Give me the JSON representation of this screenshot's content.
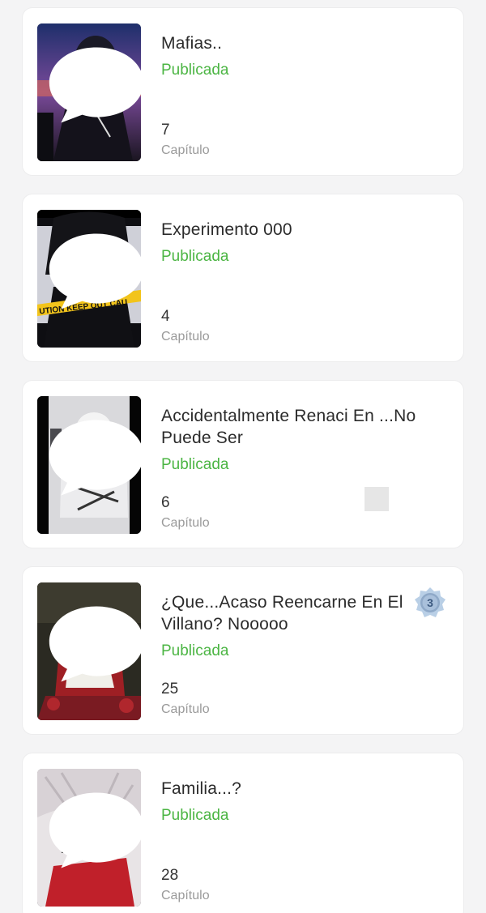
{
  "stories": [
    {
      "title": "Mafias..",
      "status": "Publicada",
      "chapters": "7",
      "chapters_label": "Capítulo",
      "cover_icon": "story-cover-image",
      "comment_icon": "comment-bubble-icon"
    },
    {
      "title": "Experimento 000",
      "status": "Publicada",
      "chapters": "4",
      "chapters_label": "Capítulo",
      "cover_icon": "story-cover-image",
      "comment_icon": "comment-bubble-icon",
      "cover_text": "UTION KEEP OUT  CAU"
    },
    {
      "title": "Accidentalmente Renaci En ...No Puede Ser",
      "status": "Publicada",
      "chapters": "6",
      "chapters_label": "Capítulo",
      "cover_icon": "story-cover-image",
      "comment_icon": "comment-bubble-icon"
    },
    {
      "title": "¿Que...Acaso Reencarne En El Villano? Nooooo",
      "status": "Publicada",
      "chapters": "25",
      "chapters_label": "Capítulo",
      "cover_icon": "story-cover-image",
      "comment_icon": "comment-bubble-icon",
      "medal_number": "3"
    },
    {
      "title": "Familia...?",
      "status": "Publicada",
      "chapters": "28",
      "chapters_label": "Capítulo",
      "cover_icon": "story-cover-image",
      "comment_icon": "comment-bubble-icon"
    }
  ],
  "colors": {
    "status": "#4bb543",
    "background": "#f4f4f5",
    "card": "#ffffff"
  }
}
